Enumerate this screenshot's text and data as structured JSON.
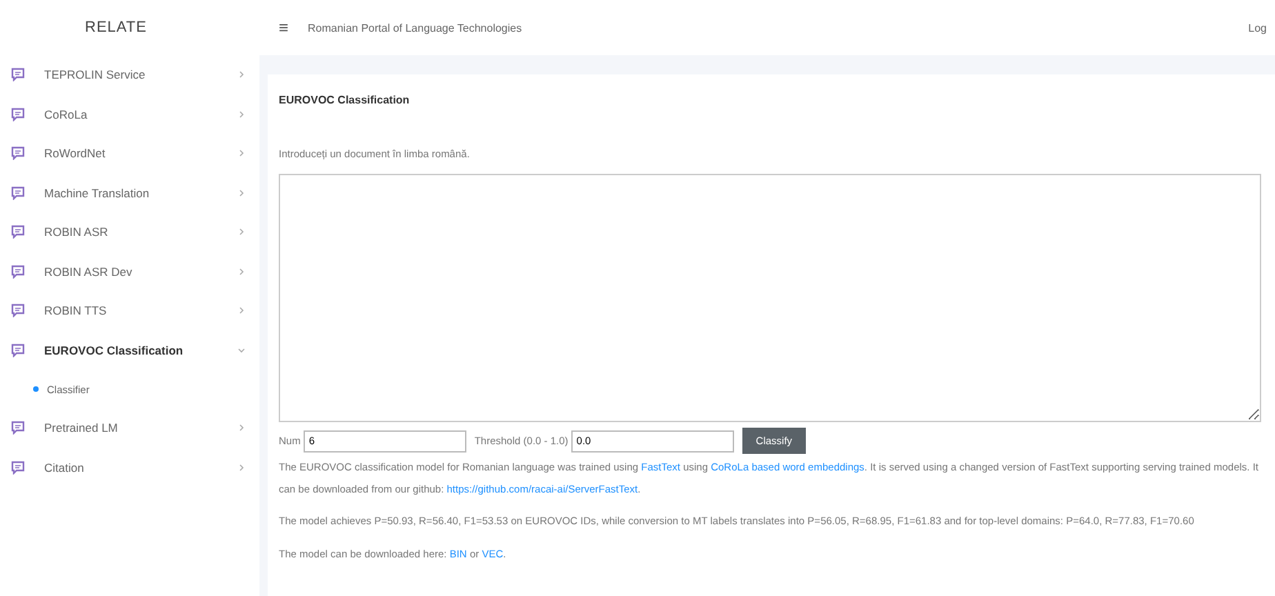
{
  "brand": "RELATE",
  "header": {
    "menu_icon": "≡",
    "title": "Romanian Portal of Language Technologies",
    "login": "Log"
  },
  "sidebar": {
    "items": [
      {
        "label": "TEPROLIN Service",
        "expanded": false
      },
      {
        "label": "CoRoLa",
        "expanded": false
      },
      {
        "label": "RoWordNet",
        "expanded": false
      },
      {
        "label": "Machine Translation",
        "expanded": false
      },
      {
        "label": "ROBIN ASR",
        "expanded": false
      },
      {
        "label": "ROBIN ASR Dev",
        "expanded": false
      },
      {
        "label": "ROBIN TTS",
        "expanded": false
      },
      {
        "label": "EUROVOC Classification",
        "expanded": true,
        "children": [
          {
            "label": "Classifier",
            "selected": true
          }
        ]
      },
      {
        "label": "Pretrained LM",
        "expanded": false
      },
      {
        "label": "Citation",
        "expanded": false
      }
    ]
  },
  "card": {
    "title": "EUROVOC Classification",
    "prompt": "Introduceți un document în limba română.",
    "num_label": "Num",
    "num_value": "6",
    "threshold_label": "Threshold (0.0 - 1.0)",
    "threshold_value": "0.0",
    "button": "Classify",
    "paragraphs": [
      [
        {
          "text": "The EUROVOC classification model for Romanian language was trained using "
        },
        {
          "text": "FastText",
          "link": true
        },
        {
          "text": " using "
        },
        {
          "text": "CoRoLa based word embeddings",
          "link": true
        },
        {
          "text": ". It is served using a changed version of FastText supporting serving trained models. It can be downloaded from our github: "
        },
        {
          "text": "https://github.com/racai-ai/ServerFastText",
          "link": true
        },
        {
          "text": "."
        }
      ],
      [
        {
          "text": "The model achieves P=50.93, R=56.40, F1=53.53 on EUROVOC IDs, while conversion to MT labels translates into P=56.05, R=68.95, F1=61.83 and for top-level domains: P=64.0, R=77.83, F1=70.60"
        }
      ],
      [
        {
          "text": "The model can be downloaded here: "
        },
        {
          "text": "BIN",
          "link": true
        },
        {
          "text": " or "
        },
        {
          "text": "VEC",
          "link": true
        },
        {
          "text": "."
        }
      ]
    ]
  }
}
